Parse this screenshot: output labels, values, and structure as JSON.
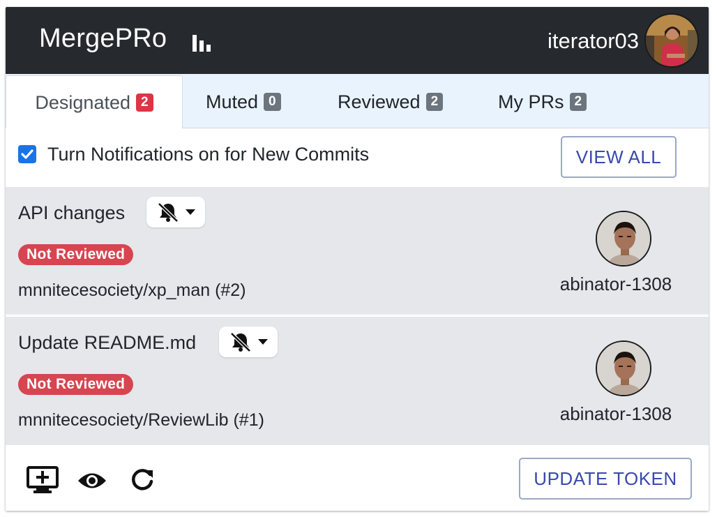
{
  "header": {
    "brand": "MergePRo",
    "brand_icon": "bar-chart-icon",
    "username": "iterator03",
    "avatar_icon": "user-avatar"
  },
  "tabs": [
    {
      "label": "Designated",
      "count": "2",
      "active": true,
      "badge_color": "#dc3545"
    },
    {
      "label": "Muted",
      "count": "0",
      "active": false,
      "badge_color": "#6c757d"
    },
    {
      "label": "Reviewed",
      "count": "2",
      "active": false,
      "badge_color": "#6c757d"
    },
    {
      "label": "My PRs",
      "count": "2",
      "active": false,
      "badge_color": "#6c757d"
    }
  ],
  "notifications": {
    "checked": true,
    "label": "Turn Notifications on for New Commits",
    "view_all_label": "VIEW ALL"
  },
  "pull_requests": [
    {
      "title": "API changes",
      "mute_icon": "bell-slash-icon",
      "status": "Not Reviewed",
      "repo": "mnnitecesociety/xp_man (#2)",
      "author": "abinator-1308"
    },
    {
      "title": "Update README.md",
      "mute_icon": "bell-slash-icon",
      "status": "Not Reviewed",
      "repo": "mnnitecesociety/ReviewLib (#1)",
      "author": "abinator-1308"
    }
  ],
  "footer": {
    "icons": [
      "monitor-plus-icon",
      "eye-icon",
      "refresh-icon"
    ],
    "update_token_label": "UPDATE TOKEN"
  },
  "colors": {
    "header_bg": "#262a2e",
    "tabs_bg": "#e9f3fd",
    "badge_red": "#dc3545",
    "badge_gray": "#6c757d",
    "status_red": "#d64550",
    "button_text": "#3949ab",
    "pr_bg": "#e5e7ea",
    "checkbox": "#1a73e8"
  }
}
